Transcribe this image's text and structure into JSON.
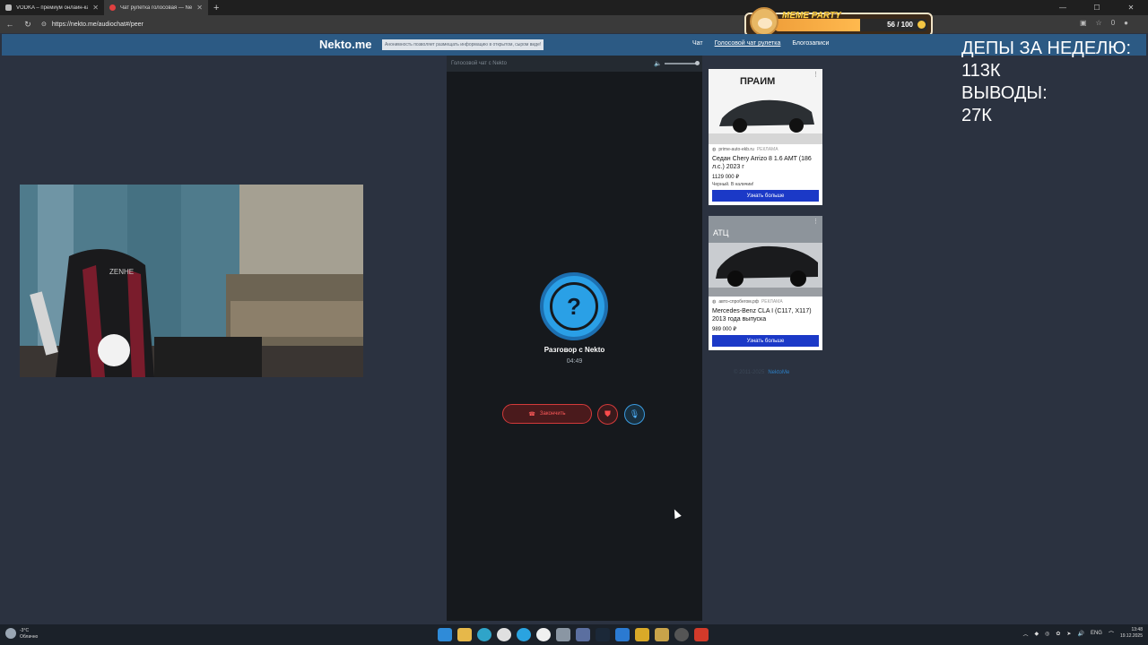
{
  "browser": {
    "tabs": [
      {
        "title": "VODKA – премиум онлайн-кази…",
        "active": false
      },
      {
        "title": "Чат рулетка голосовая — Ne…",
        "active": true
      }
    ],
    "url": "https://nekto.me/audiochat#/peer",
    "extension_badge": "0"
  },
  "site": {
    "logo": "Nekto.me",
    "notice": "Анонимность позволяет размещать информацию в открытом, сыром виде!",
    "nav": [
      {
        "label": "Чат",
        "active": false
      },
      {
        "label": "Голосовой чат рулетка",
        "active": true
      },
      {
        "label": "Блогозаписи",
        "active": false
      }
    ]
  },
  "overlay": {
    "stats_lines": [
      "ДЕПЫ ЗА НЕДЕЛЮ:",
      "113К",
      "ВЫВОДЫ:",
      "27К"
    ],
    "meme_title": "MEME PARTY",
    "meme_count": "56 / 100",
    "meme_fraction": 0.56
  },
  "webcam": {
    "chair_text": "ZENHE"
  },
  "chat": {
    "header": "Голосовой чат с Nekto",
    "peer_name": "Разговор с Nekto",
    "timer": "04:49",
    "end_label": "Закончить",
    "avatar_glyph": "?"
  },
  "ads": [
    {
      "brand": "ПРАИМ",
      "source": "prime-auto-ekb.ru",
      "tag": "РЕКЛАМА",
      "title": "Седан Chery Arrizo 8 1.6 AMT (186 л.с.) 2023 г",
      "price": "1129 000 ₽",
      "note": "Черный. В наличии!",
      "cta": "Узнать больше"
    },
    {
      "brand": "АТЦ",
      "source": "авто-спробегом.рф",
      "tag": "РЕКЛАМА",
      "title": "Mercedes-Benz CLA I (C117, X117) 2013 года выпуска",
      "price": "989 000 ₽",
      "note": "",
      "cta": "Узнать больше"
    }
  ],
  "footer": {
    "copyright": "© 2011-2025",
    "link": "NektoMe"
  },
  "taskbar": {
    "temperature": "-3°C",
    "weather": "Облачно",
    "lang": "ENG",
    "time": "13:48",
    "date": "19.12.2025"
  }
}
